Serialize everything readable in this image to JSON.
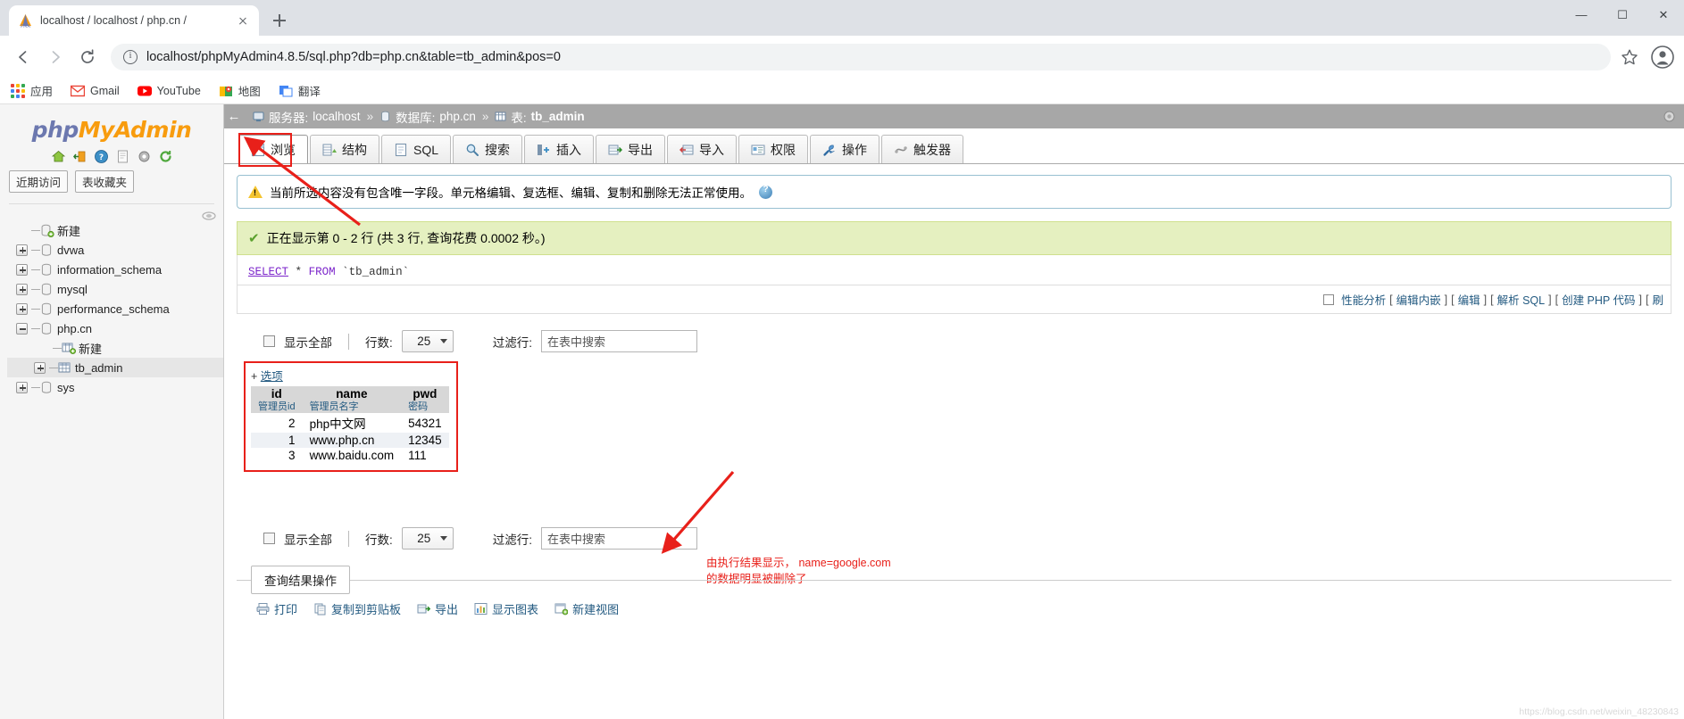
{
  "browser": {
    "tab": {
      "title": "localhost / localhost / php.cn /",
      "favicon": "phpmyadmin-icon",
      "close": "close-icon"
    },
    "new_tab": "new-tab-icon",
    "window_controls": {
      "minimize": "—",
      "maximize": "☐",
      "close": "✕"
    },
    "nav": {
      "back": "back-arrow-icon",
      "forward": "forward-arrow-icon",
      "reload": "reload-icon"
    },
    "omnibox": {
      "url": "localhost/phpMyAdmin4.8.5/sql.php?db=php.cn&table=tb_admin&pos=0",
      "info_icon": "info-icon",
      "star_icon": "bookmark-star-icon",
      "profile_icon": "profile-avatar-icon"
    },
    "bookmarks": [
      {
        "label": "应用",
        "icon": "apps-grid-icon"
      },
      {
        "label": "Gmail",
        "icon": "gmail-icon"
      },
      {
        "label": "YouTube",
        "icon": "youtube-icon"
      },
      {
        "label": "地图",
        "icon": "maps-icon"
      },
      {
        "label": "翻译",
        "icon": "translate-icon"
      }
    ]
  },
  "sidebar": {
    "logo": {
      "part1": "php",
      "part2": "My",
      "part3": "Admin"
    },
    "icons": [
      {
        "name": "home-icon"
      },
      {
        "name": "logout-icon"
      },
      {
        "name": "help-icon"
      },
      {
        "name": "docs-icon"
      },
      {
        "name": "settings-gear-icon"
      },
      {
        "name": "refresh-icon"
      }
    ],
    "pills": [
      {
        "label": "近期访问"
      },
      {
        "label": "表收藏夹"
      }
    ],
    "pin_icon": "pin-icon",
    "tree": [
      {
        "label": "新建",
        "toggle": "none",
        "icon": "new-db-icon",
        "indent": 0,
        "selected": false
      },
      {
        "label": "dvwa",
        "toggle": "plus",
        "icon": "db-icon",
        "indent": 0,
        "selected": false
      },
      {
        "label": "information_schema",
        "toggle": "plus",
        "icon": "db-icon",
        "indent": 0,
        "selected": false
      },
      {
        "label": "mysql",
        "toggle": "plus",
        "icon": "db-icon",
        "indent": 0,
        "selected": false
      },
      {
        "label": "performance_schema",
        "toggle": "plus",
        "icon": "db-icon",
        "indent": 0,
        "selected": false
      },
      {
        "label": "php.cn",
        "toggle": "minus",
        "icon": "db-icon",
        "indent": 0,
        "selected": false
      },
      {
        "label": "新建",
        "toggle": "none",
        "icon": "new-table-icon",
        "indent": 1,
        "selected": false
      },
      {
        "label": "tb_admin",
        "toggle": "plus",
        "icon": "table-icon",
        "indent": 2,
        "selected": true
      },
      {
        "label": "sys",
        "toggle": "plus",
        "icon": "db-icon",
        "indent": 0,
        "selected": false
      }
    ]
  },
  "breadcrumb": {
    "back_icon": "back-arrow-icon",
    "server_label": "服务器:",
    "server_value": "localhost",
    "sep1": "»",
    "db_label": "数据库:",
    "db_value": "php.cn",
    "sep2": "»",
    "table_label": "表:",
    "table_value": "tb_admin",
    "gear_icon": "settings-gear-icon"
  },
  "tabs": [
    {
      "label": "浏览",
      "icon": "browse-icon",
      "active": true
    },
    {
      "label": "结构",
      "icon": "structure-icon",
      "active": false
    },
    {
      "label": "SQL",
      "icon": "sql-icon",
      "active": false
    },
    {
      "label": "搜索",
      "icon": "search-icon",
      "active": false
    },
    {
      "label": "插入",
      "icon": "insert-icon",
      "active": false
    },
    {
      "label": "导出",
      "icon": "export-icon",
      "active": false
    },
    {
      "label": "导入",
      "icon": "import-icon",
      "active": false
    },
    {
      "label": "权限",
      "icon": "privileges-icon",
      "active": false
    },
    {
      "label": "操作",
      "icon": "operations-wrench-icon",
      "active": false
    },
    {
      "label": "触发器",
      "icon": "triggers-icon",
      "active": false
    }
  ],
  "notice": {
    "icon": "warning-triangle-icon",
    "text": "当前所选内容没有包含唯一字段。单元格编辑、复选框、编辑、复制和删除无法正常使用。",
    "help_icon": "help-question-icon"
  },
  "result": {
    "check_icon": "check-mark-icon",
    "message": "正在显示第 0 - 2 行 (共 3 行, 查询花费 0.0002 秒。)",
    "sql": {
      "select": "SELECT",
      "star": "*",
      "from": "FROM",
      "table": "`tb_admin`"
    }
  },
  "query_links": {
    "checkbox_label": "性能分析",
    "items": [
      "编辑内嵌",
      "编辑",
      "解析 SQL",
      "创建 PHP 代码",
      "刷"
    ]
  },
  "controls_top": {
    "show_all_label": "显示全部",
    "rows_label": "行数:",
    "rows_value": "25",
    "filter_label": "过滤行:",
    "filter_placeholder": "在表中搜索"
  },
  "controls_bottom": {
    "show_all_label": "显示全部",
    "rows_label": "行数:",
    "rows_value": "25",
    "filter_label": "过滤行:",
    "filter_placeholder": "在表中搜索"
  },
  "table": {
    "options_plus": "+",
    "options_label": "选项",
    "columns": [
      {
        "name": "id",
        "comment": "管理员id"
      },
      {
        "name": "name",
        "comment": "管理员名字"
      },
      {
        "name": "pwd",
        "comment": "密码"
      }
    ],
    "rows": [
      {
        "id": "2",
        "name": "php中文网",
        "pwd": "54321"
      },
      {
        "id": "1",
        "name": "www.php.cn",
        "pwd": "12345"
      },
      {
        "id": "3",
        "name": "www.baidu.com",
        "pwd": "111"
      }
    ]
  },
  "annotation": {
    "line1": "由执行结果显示， name=google.com",
    "line2": "的数据明显被删除了",
    "color": "#e8201a"
  },
  "result_ops": {
    "title": "查询结果操作",
    "items": [
      {
        "label": "打印",
        "icon": "print-icon"
      },
      {
        "label": "复制到剪贴板",
        "icon": "clipboard-icon"
      },
      {
        "label": "导出",
        "icon": "export-icon"
      },
      {
        "label": "显示图表",
        "icon": "chart-icon"
      },
      {
        "label": "新建视图",
        "icon": "view-icon"
      }
    ]
  },
  "watermark": "https://blog.csdn.net/weixin_48230843",
  "colors": {
    "accent_orange": "#f89c0e",
    "accent_blue": "#6c78af",
    "link": "#235a81",
    "red_highlight": "#e8201a",
    "success_bg": "#e5f0c0",
    "crumb_bg": "#a7a7a7"
  }
}
